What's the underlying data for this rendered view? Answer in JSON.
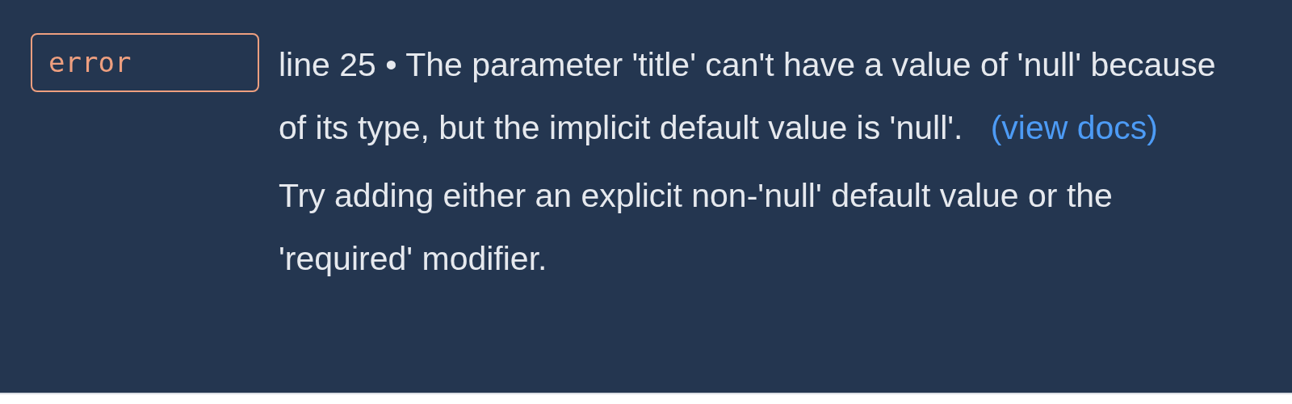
{
  "diagnostic": {
    "severity": "error",
    "message": "line 25 • The parameter 'title' can't have a value of 'null' because of its type, but the implicit default value is 'null'.",
    "link": "(view docs)",
    "correction": "Try adding either an explicit non-'null' default value or the 'required' modifier."
  }
}
